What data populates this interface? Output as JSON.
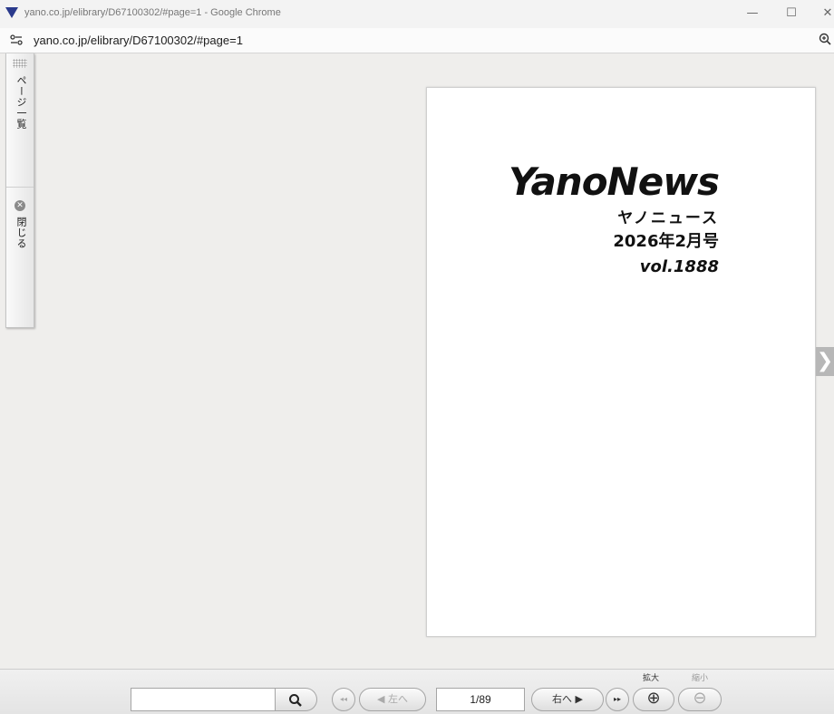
{
  "window": {
    "title": "yano.co.jp/elibrary/D67100302/#page=1 - Google Chrome",
    "min_glyph": "—",
    "max_glyph": "☐",
    "close_glyph": "✕"
  },
  "addressbar": {
    "url": "yano.co.jp/elibrary/D67100302/#page=1"
  },
  "sidebar": {
    "page_list_label": "ページ一覧",
    "close_label": "閉じる",
    "close_glyph": "✕"
  },
  "page": {
    "title": "YanoNews",
    "kana": "ヤノニュース",
    "issue": "2026年2月号",
    "vol": "vol.1888"
  },
  "toolbar": {
    "search_value": "",
    "first_glyph": "◂◂",
    "prev_label": "◀ 左へ",
    "page_indicator": "1/89",
    "next_label": "右へ ▶",
    "last_glyph": "▸▸",
    "zoom_in_label": "拡大",
    "zoom_out_label": "縮小",
    "zoom_in_glyph": "⊕",
    "zoom_out_glyph": "⊖"
  },
  "nav": {
    "next_page_glyph": "❯"
  },
  "colors": {
    "logo": "#2a3a8c",
    "background": "#efeeec"
  }
}
